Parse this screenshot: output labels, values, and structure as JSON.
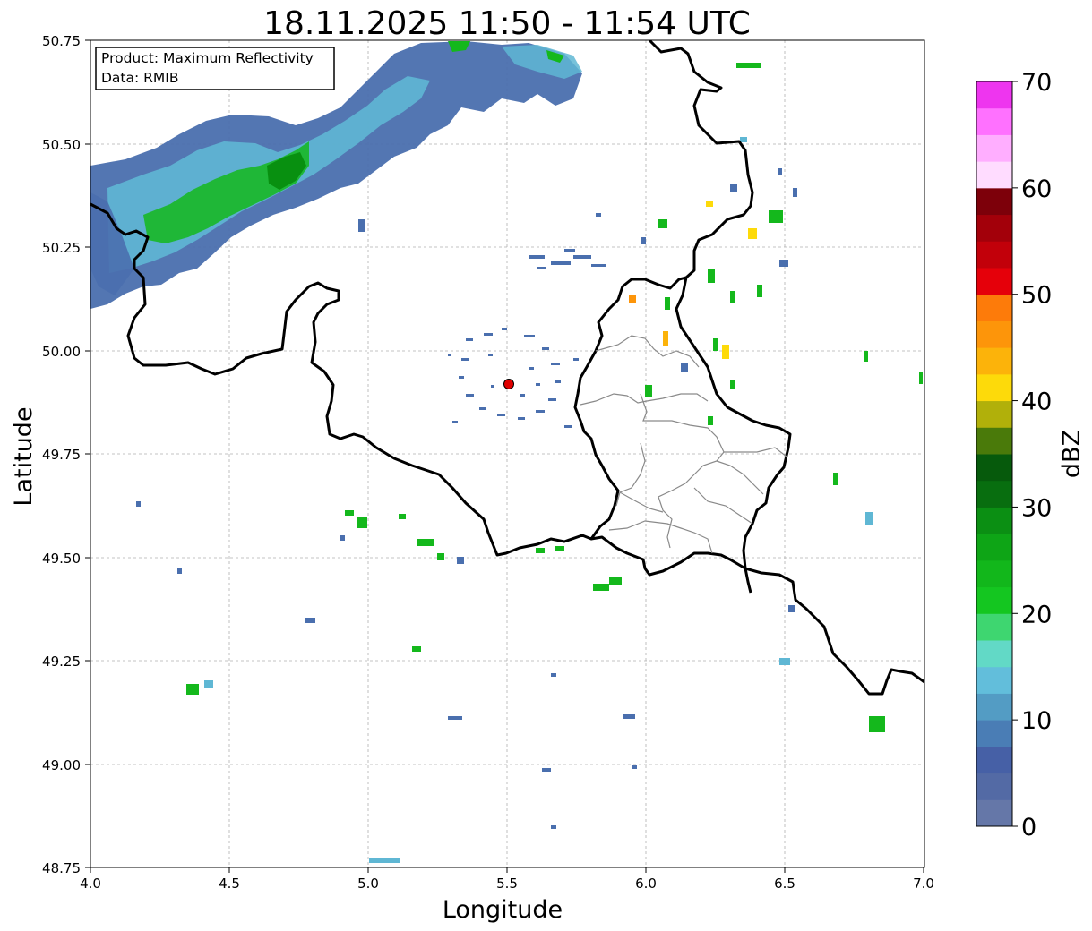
{
  "title": "18.11.2025 11:50 - 11:54 UTC",
  "xlabel": "Longitude",
  "ylabel": "Latitude",
  "info_box": {
    "product": "Product: Maximum Reflectivity",
    "data": "Data: RMIB"
  },
  "x_ticks": [
    "4.0",
    "4.5",
    "5.0",
    "5.5",
    "6.0",
    "6.5",
    "7.0"
  ],
  "y_ticks": [
    "50.75",
    "50.50",
    "50.25",
    "50.00",
    "49.75",
    "49.50",
    "49.25",
    "49.00",
    "48.75"
  ],
  "colorbar": {
    "label": "dBZ",
    "ticks": [
      "0",
      "10",
      "20",
      "30",
      "40",
      "50",
      "60",
      "70"
    ],
    "colors": [
      "#6577a8",
      "#536aa5",
      "#4660a6",
      "#4a7db5",
      "#539cc4",
      "#62bedb",
      "#62d9c6",
      "#3ed670",
      "#14c620",
      "#12b71b",
      "#0ea516",
      "#0b8f13",
      "#086e0f",
      "#065a0c",
      "#4a7a0a",
      "#b1b00a",
      "#fdda0a",
      "#fcb30a",
      "#fd950a",
      "#fd7b0a",
      "#e5000a",
      "#c2000a",
      "#a3000a",
      "#7d000a",
      "#ffdcff",
      "#ffaeff",
      "#ff71ff",
      "#ee35ef"
    ]
  },
  "radar_site": {
    "lon": 5.505,
    "lat": 49.914,
    "color": "#e00000"
  },
  "extent": {
    "lon": [
      4.0,
      7.0
    ],
    "lat": [
      48.75,
      50.75
    ]
  },
  "legend_colors": {
    "border": "#000000",
    "admin": "#8a8a8a",
    "grid": "#b0b0b0"
  }
}
